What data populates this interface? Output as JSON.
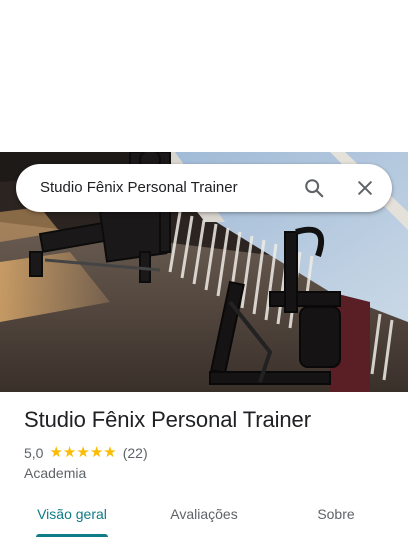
{
  "search": {
    "query": "Studio Fênix Personal Trainer",
    "search_icon": "search-icon",
    "close_icon": "close-icon"
  },
  "hero": {
    "image_name": "gym-interior-photo"
  },
  "place": {
    "title": "Studio Fênix Personal Trainer",
    "rating_value": "5,0",
    "stars": 5,
    "review_count": "(22)",
    "category": "Academia"
  },
  "tabs": [
    {
      "label": "Visão geral",
      "active": true
    },
    {
      "label": "Avaliações",
      "active": false
    },
    {
      "label": "Sobre",
      "active": false
    }
  ],
  "colors": {
    "accent": "#0e7c86",
    "star": "#fbbc04",
    "title_text": "#202124",
    "secondary_text": "#5f6368"
  }
}
